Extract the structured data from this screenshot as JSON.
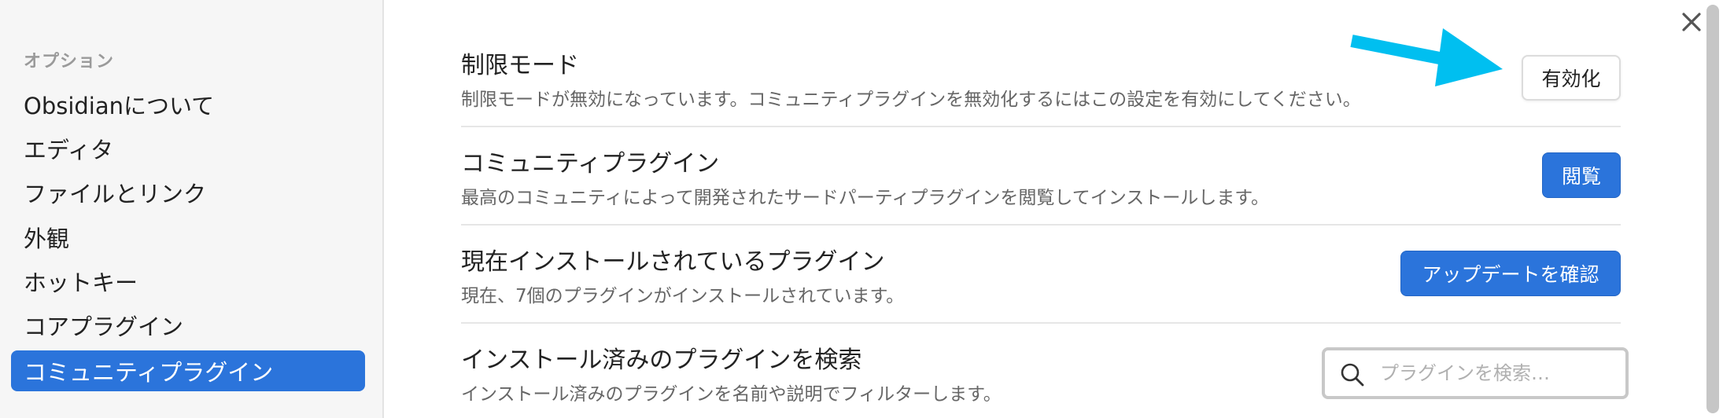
{
  "sidebar": {
    "heading": "オプション",
    "items": [
      {
        "label": "Obsidianについて"
      },
      {
        "label": "エディタ"
      },
      {
        "label": "ファイルとリンク"
      },
      {
        "label": "外観"
      },
      {
        "label": "ホットキー"
      },
      {
        "label": "コアプラグイン"
      },
      {
        "label": "コミュニティプラグイン",
        "active": true
      }
    ]
  },
  "main": {
    "restricted_mode": {
      "title": "制限モード",
      "description": "制限モードが無効になっています。コミュニティプラグインを無効化するにはこの設定を有効にしてください。",
      "button": "有効化"
    },
    "community_plugins": {
      "title": "コミュニティプラグイン",
      "description": "最高のコミュニティによって開発されたサードパーティプラグインを閲覧してインストールします。",
      "button": "閲覧"
    },
    "installed_plugins": {
      "title": "現在インストールされているプラグイン",
      "description": "現在、7個のプラグインがインストールされています。",
      "button": "アップデートを確認"
    },
    "search_installed": {
      "title": "インストール済みのプラグインを検索",
      "description": "インストール済みのプラグインを名前や説明でフィルターします。",
      "placeholder": "プラグインを検索…",
      "value": ""
    }
  },
  "icons": {
    "close": "close-icon",
    "search": "search-icon",
    "annotation": "arrow-annotation"
  },
  "colors": {
    "accent": "#2b74db",
    "annotation_arrow": "#00bff0",
    "sidebar_bg": "#f6f6f6"
  }
}
